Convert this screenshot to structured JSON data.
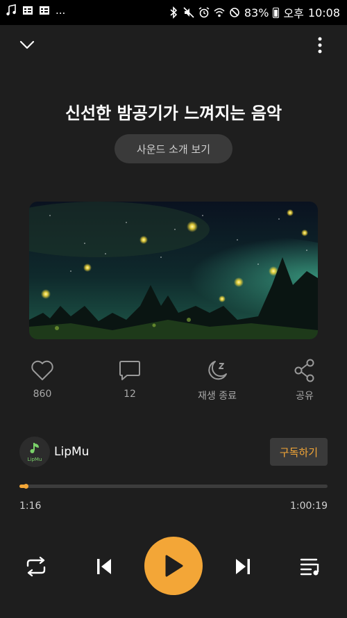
{
  "status_bar": {
    "overflow": "...",
    "battery_percent": "83%",
    "ampm": "오후",
    "time": "10:08"
  },
  "title": "신선한 밤공기가 느껴지는 음악",
  "sound_intro_button": "사운드 소개 보기",
  "actions": {
    "like_count": "860",
    "comment_count": "12",
    "sleep_timer_label": "재생 종료",
    "share_label": "공유"
  },
  "channel": {
    "name": "LipMu",
    "avatar_text": "LipMu",
    "subscribe_label": "구독하기"
  },
  "player": {
    "current_time": "1:16",
    "total_time": "1:00:19",
    "progress": 0.021
  },
  "colors": {
    "accent": "#f3a637",
    "background": "#1e1e1e",
    "button_bg": "#3a3a3a"
  },
  "icons": [
    "collapse-chevron-icon",
    "more-vert-icon",
    "heart-icon",
    "comment-icon",
    "moon-sleep-icon",
    "share-icon",
    "repeat-icon",
    "skip-previous-icon",
    "play-icon",
    "skip-next-icon",
    "playlist-icon"
  ]
}
